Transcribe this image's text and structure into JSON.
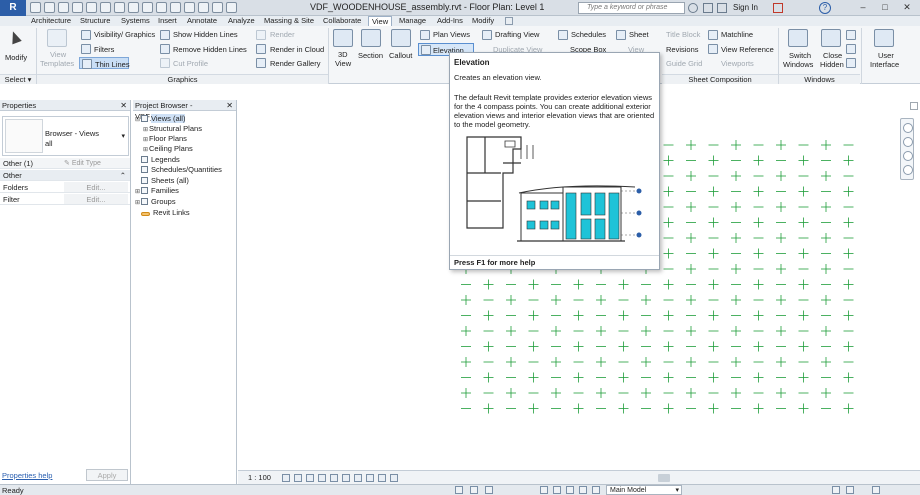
{
  "titlebar": {
    "app_letter": "R",
    "title": "VDF_WOODENHOUSE_assembly.rvt - Floor Plan: Level 1",
    "search_placeholder": "Type a keyword or phrase",
    "sign_in": "Sign In",
    "help": "?"
  },
  "tabs": [
    "Architecture",
    "Structure",
    "Systems",
    "Insert",
    "Annotate",
    "Analyze",
    "Massing & Site",
    "Collaborate",
    "View",
    "Manage",
    "Add-Ins",
    "Modify"
  ],
  "active_tab": "View",
  "ribbon": {
    "modify": "Modify",
    "view_templates_1": "View",
    "view_templates_2": "Templates",
    "visibility": "Visibility/ Graphics",
    "filters": "Filters",
    "thin_lines": "Thin Lines",
    "show_hidden": "Show Hidden Lines",
    "remove_hidden": "Remove Hidden Lines",
    "cut_profile": "Cut Profile",
    "render": "Render",
    "render_cloud": "Render in Cloud",
    "render_gallery": "Render Gallery",
    "view_3d_1": "3D",
    "view_3d_2": "View",
    "section": "Section",
    "callout": "Callout",
    "plan_views": "Plan Views",
    "drafting_view": "Drafting View",
    "elevation": "Elevation",
    "duplicate_view": "Duplicate View",
    "schedules": "Schedules",
    "scope_box": "Scope Box",
    "sheet": "Sheet",
    "title_block": "Title Block",
    "matchline": "Matchline",
    "sheet_view": "View",
    "revisions": "Revisions",
    "view_reference": "View Reference",
    "guide_grid": "Guide Grid",
    "viewports": "Viewports",
    "switch_windows_1": "Switch",
    "switch_windows_2": "Windows",
    "close_hidden_1": "Close",
    "close_hidden_2": "Hidden",
    "user_interface_1": "User",
    "user_interface_2": "Interface",
    "panel_select": "Select",
    "panel_graphics": "Graphics",
    "panel_sheet_composition": "Sheet Composition",
    "panel_windows": "Windows"
  },
  "properties": {
    "title": "Properties",
    "type_name": "Browser - Views",
    "type_sub": "all",
    "filter_label": "Other (1)",
    "edit_type": "Edit Type",
    "group_other": "Other",
    "row_folders": "Folders",
    "row_filter": "Filter",
    "edit": "Edit...",
    "help_link": "Properties help",
    "apply": "Apply"
  },
  "browser": {
    "title": "Project Browser - VDF_WOO...",
    "items": [
      {
        "label": "Views (all)",
        "indent": 0,
        "exp": "-"
      },
      {
        "label": "Structural Plans",
        "indent": 1,
        "exp": "+"
      },
      {
        "label": "Floor Plans",
        "indent": 1,
        "exp": "+"
      },
      {
        "label": "Ceiling Plans",
        "indent": 1,
        "exp": "+"
      },
      {
        "label": "Legends",
        "indent": 0,
        "exp": ""
      },
      {
        "label": "Schedules/Quantities",
        "indent": 0,
        "exp": ""
      },
      {
        "label": "Sheets (all)",
        "indent": 0,
        "exp": ""
      },
      {
        "label": "Families",
        "indent": 0,
        "exp": "+"
      },
      {
        "label": "Groups",
        "indent": 0,
        "exp": "+"
      },
      {
        "label": "Revit Links",
        "indent": 0,
        "exp": ""
      }
    ]
  },
  "tooltip": {
    "title": "Elevation",
    "subtitle": "Creates an elevation view.",
    "description": "The default Revit template provides exterior elevation views for the 4 compass points. You can create additional exterior elevation views and interior elevation views that are oriented to the model geometry.",
    "footer": "Press F1 for more help"
  },
  "view_bar": {
    "scale": "1 : 100"
  },
  "status": {
    "ready": "Ready",
    "model": "Main Model"
  },
  "colors": {
    "grid_green": "#1f9e3a",
    "accent_blue": "#2c5ea8",
    "glass_cyan": "#1fc3d8"
  }
}
